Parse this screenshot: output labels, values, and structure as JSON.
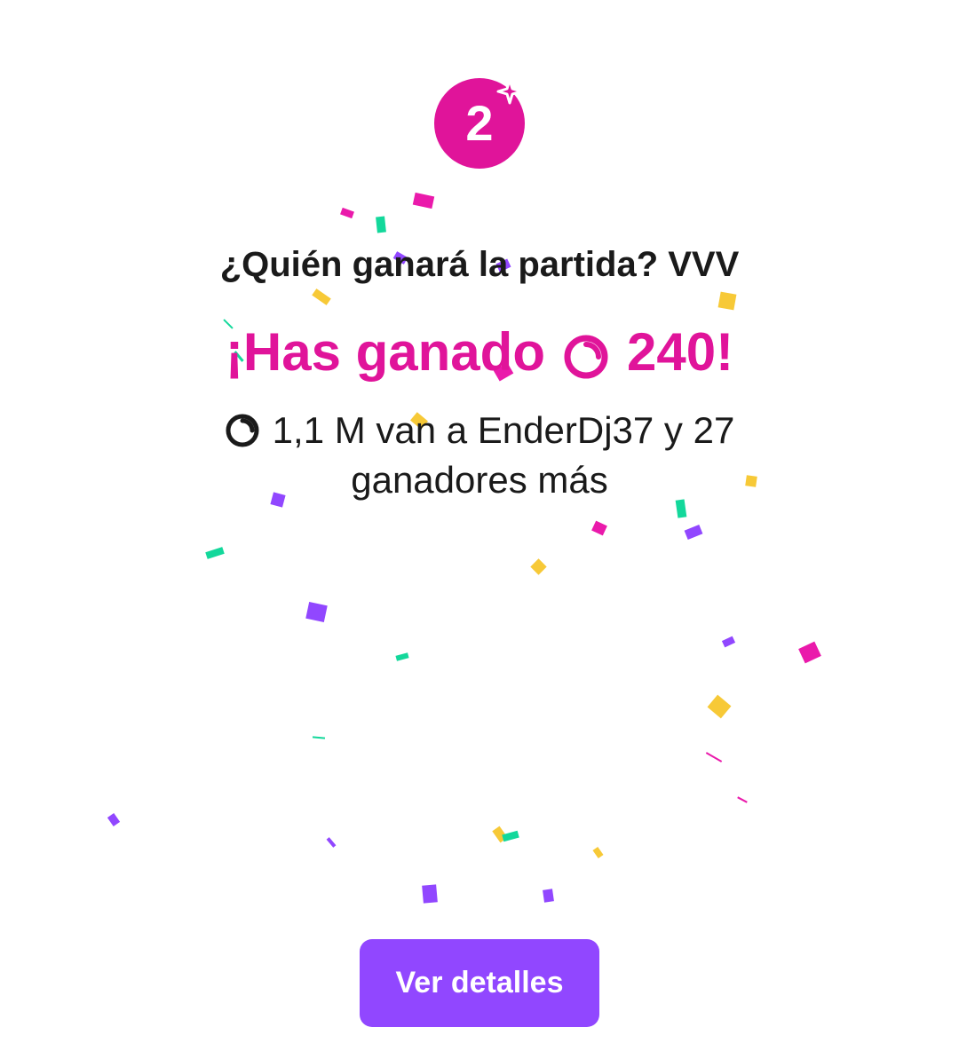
{
  "prediction": {
    "title": "¿Quién ganará la partida? VVV",
    "won_prefix": "¡Has ganado",
    "won_amount": "240!",
    "payout_line": "1,1 M van a EnderDj37 y 27 ganadores más",
    "badge_number": "2"
  },
  "actions": {
    "details_label": "Ver detalles"
  },
  "icons": {
    "badge": "rank-badge-icon",
    "points": "channel-points-icon"
  },
  "colors": {
    "accent_pink": "#e0149a",
    "button_purple": "#9147ff",
    "text_dark": "#1a1a1a",
    "confetti": [
      "#ea1aab",
      "#13d89b",
      "#9147ff",
      "#f7c937"
    ]
  }
}
